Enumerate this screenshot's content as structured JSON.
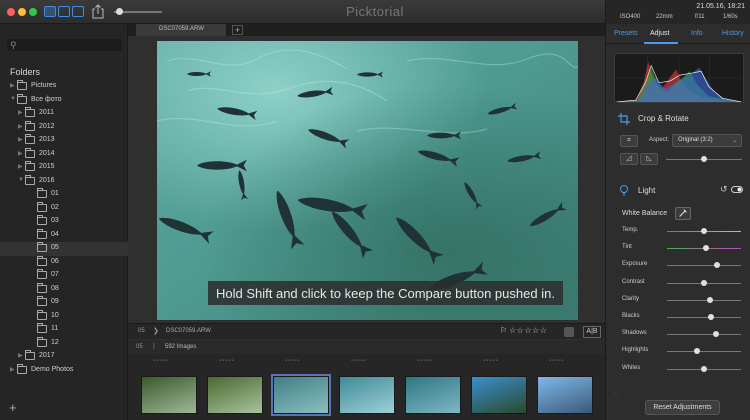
{
  "app": {
    "title": "Picktorial"
  },
  "toolbar": {
    "zoom": 0.1
  },
  "sidebar": {
    "search": {
      "placeholder": ""
    },
    "folders_title": "Folders",
    "tree": [
      {
        "label": "Pictures",
        "level": 0,
        "expanded": false,
        "selected": false
      },
      {
        "label": "Все фото",
        "level": 0,
        "expanded": true,
        "selected": false
      },
      {
        "label": "2011",
        "level": 1,
        "expanded": false,
        "selected": false
      },
      {
        "label": "2012",
        "level": 1,
        "expanded": false,
        "selected": false
      },
      {
        "label": "2013",
        "level": 1,
        "expanded": false,
        "selected": false
      },
      {
        "label": "2014",
        "level": 1,
        "expanded": false,
        "selected": false
      },
      {
        "label": "2015",
        "level": 1,
        "expanded": false,
        "selected": false
      },
      {
        "label": "2016",
        "level": 1,
        "expanded": true,
        "selected": false
      },
      {
        "label": "01",
        "level": 2,
        "expanded": false,
        "selected": false
      },
      {
        "label": "02",
        "level": 2,
        "expanded": false,
        "selected": false
      },
      {
        "label": "03",
        "level": 2,
        "expanded": false,
        "selected": false
      },
      {
        "label": "04",
        "level": 2,
        "expanded": false,
        "selected": false
      },
      {
        "label": "05",
        "level": 2,
        "expanded": false,
        "selected": true
      },
      {
        "label": "06",
        "level": 2,
        "expanded": false,
        "selected": false
      },
      {
        "label": "07",
        "level": 2,
        "expanded": false,
        "selected": false
      },
      {
        "label": "08",
        "level": 2,
        "expanded": false,
        "selected": false
      },
      {
        "label": "09",
        "level": 2,
        "expanded": false,
        "selected": false
      },
      {
        "label": "10",
        "level": 2,
        "expanded": false,
        "selected": false
      },
      {
        "label": "11",
        "level": 2,
        "expanded": false,
        "selected": false
      },
      {
        "label": "12",
        "level": 2,
        "expanded": false,
        "selected": false
      },
      {
        "label": "2017",
        "level": 1,
        "expanded": false,
        "selected": false
      },
      {
        "label": "Demo Photos",
        "level": 0,
        "expanded": false,
        "selected": false
      }
    ],
    "add_label": "+"
  },
  "tabs": [
    {
      "label": "DSC07059.ARW"
    }
  ],
  "tab_add": "+",
  "viewer": {
    "hint": "Hold Shift and click to keep the Compare button pushed in."
  },
  "infobar": {
    "folder_num": "05",
    "chevron": "❯",
    "filename": "DSC07059.ARW",
    "flag": "⚐",
    "stars": "☆☆☆☆☆",
    "compare_label": "A|B"
  },
  "filmstrip": {
    "folder_num": "05",
    "separator": "|",
    "count": "592 Images",
    "selected_index": 2,
    "thumbs": [
      {
        "name": "thumb-waterfall-1",
        "colors": [
          "#3a5a2a",
          "#9db89a"
        ]
      },
      {
        "name": "thumb-waterfall-2",
        "colors": [
          "#4a6a30",
          "#a8c2a0"
        ]
      },
      {
        "name": "thumb-fish",
        "colors": [
          "#3f7f86",
          "#8bbfbf"
        ]
      },
      {
        "name": "thumb-water-1",
        "colors": [
          "#3e8a96",
          "#9ed0d8"
        ]
      },
      {
        "name": "thumb-water-2",
        "colors": [
          "#2e7685",
          "#7fb7c2"
        ]
      },
      {
        "name": "thumb-lake-1",
        "colors": [
          "#3a8fd0",
          "#2a4a2a"
        ]
      },
      {
        "name": "thumb-lake-2",
        "colors": [
          "#7fb8e8",
          "#3a5a7a"
        ]
      }
    ]
  },
  "exif": {
    "datetime": "21.05.16, 18:21",
    "iso": "ISO400",
    "focal": "22mm",
    "aperture": "f/11",
    "shutter": "1/60s"
  },
  "right_tabs": [
    {
      "label": "Presets",
      "active": false
    },
    {
      "label": "Adjust",
      "active": true
    },
    {
      "label": "Info",
      "active": false
    },
    {
      "label": "History",
      "active": false
    }
  ],
  "crop": {
    "title": "Crop & Rotate",
    "aspect_label": "Aspect:",
    "aspect_value": "Original (3:2)",
    "straighten": 0.5
  },
  "light": {
    "title": "Light",
    "wb_label": "White Balance",
    "adjustments": [
      {
        "label": "Temp.",
        "value": 0.5,
        "track": "temp"
      },
      {
        "label": "Tint",
        "value": 0.53,
        "track": "tint"
      },
      {
        "label": "Exposure",
        "value": 0.68,
        "track": "plain"
      },
      {
        "label": "Contrast",
        "value": 0.5,
        "track": "plain"
      },
      {
        "label": "Clarity",
        "value": 0.58,
        "track": "plain"
      },
      {
        "label": "Blacks",
        "value": 0.6,
        "track": "plain"
      },
      {
        "label": "Shadows",
        "value": 0.66,
        "track": "plain"
      },
      {
        "label": "Highlights",
        "value": 0.4,
        "track": "plain"
      },
      {
        "label": "Whites",
        "value": 0.5,
        "track": "plain"
      }
    ]
  },
  "reset_label": "Reset Adjustments",
  "colors": {
    "accent": "#4b9be8",
    "selection": "#5a73b5"
  }
}
